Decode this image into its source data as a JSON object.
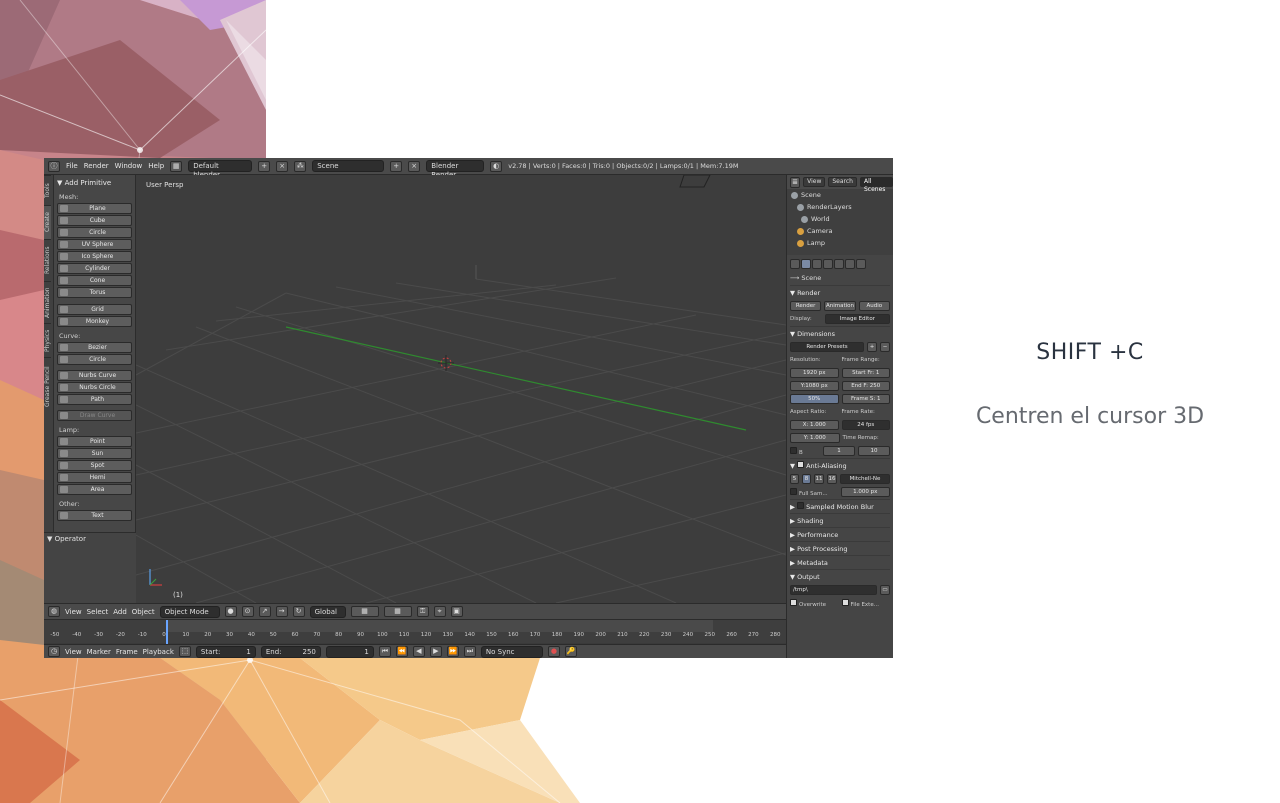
{
  "slide": {
    "title": "SHIFT +C",
    "body": "Centren el cursor 3D"
  },
  "blender": {
    "top_menu": [
      "File",
      "Render",
      "Window",
      "Help"
    ],
    "layout": "Default blender",
    "scene": "Scene",
    "engine": "Blender Render",
    "stats": "v2.78 | Verts:0 | Faces:0 | Tris:0 | Objects:0/2 | Lamps:0/1 | Mem:7.19M",
    "tabs": [
      "Tools",
      "Create",
      "Relations",
      "Animation",
      "Physics",
      "Grease Pencil"
    ],
    "shelf": {
      "header": "▼ Add Primitive",
      "mesh_label": "Mesh:",
      "mesh": [
        "Plane",
        "Cube",
        "Circle",
        "UV Sphere",
        "Ico Sphere",
        "Cylinder",
        "Cone",
        "Torus"
      ],
      "mesh2": [
        "Grid",
        "Monkey"
      ],
      "curve_label": "Curve:",
      "curve": [
        "Bezier",
        "Circle"
      ],
      "nurbs": [
        "Nurbs Curve",
        "Nurbs Circle",
        "Path"
      ],
      "draw_curve": "Draw Curve",
      "lamp_label": "Lamp:",
      "lamp": [
        "Point",
        "Sun",
        "Spot",
        "Hemi",
        "Area"
      ],
      "other_label": "Other:",
      "other": [
        "Text"
      ],
      "operator": "▼ Operator"
    },
    "viewport": {
      "label": "User Persp",
      "frame": "(1)"
    },
    "header3d": {
      "menus": [
        "View",
        "Select",
        "Add",
        "Object"
      ],
      "mode": "Object Mode",
      "orientation": "Global"
    },
    "ruler": [
      "-50",
      "-40",
      "-30",
      "-20",
      "-10",
      "0",
      "10",
      "20",
      "30",
      "40",
      "50",
      "60",
      "70",
      "80",
      "90",
      "100",
      "110",
      "120",
      "130",
      "140",
      "150",
      "160",
      "170",
      "180",
      "190",
      "200",
      "210",
      "220",
      "230",
      "240",
      "250",
      "260",
      "270",
      "280"
    ],
    "footer": {
      "menus": [
        "View",
        "Marker",
        "Frame",
        "Playback"
      ],
      "start": "Start:",
      "start_val": "1",
      "end": "End:",
      "end_val": "250",
      "current": "1",
      "sync": "No Sync"
    },
    "outliner": {
      "buttons": [
        "View",
        "Search",
        "All Scenes"
      ],
      "rows": [
        "Scene",
        "RenderLayers",
        "World",
        "Camera",
        "Lamp"
      ]
    },
    "props": {
      "scene_line": "Scene",
      "render_panel": "▼ Render",
      "render_buttons": [
        "Render",
        "Animation",
        "Audio"
      ],
      "display_label": "Display:",
      "display_value": "Image Editor",
      "dimensions_panel": "▼ Dimensions",
      "presets": "Render Presets",
      "resolution_label": "Resolution:",
      "frame_range_label": "Frame Range:",
      "res_x": "1920 px",
      "res_y": "Y:1080 px",
      "res_pct": "50%",
      "start_fr": "Start Fr: 1",
      "end_fr": "End F: 250",
      "frame_step": "Frame S: 1",
      "aspect_label": "Aspect Ratio:",
      "frame_rate_label": "Frame Rate:",
      "aspect_x": "X: 1.000",
      "aspect_y": "Y: 1.000",
      "fps": "24 fps",
      "time_remap": "Time Remap:",
      "remap_old": "1",
      "remap_new": "10",
      "border_b": "B",
      "aa_panel": "Anti-Aliasing",
      "aa_samples": [
        "5",
        "8",
        "11",
        "16"
      ],
      "aa_filter": "Mitchell-Ne",
      "full_sample": "Full Sam...",
      "filter_size": "1.000 px",
      "motion_blur": "Sampled Motion Blur",
      "collapsed": [
        "▶ Shading",
        "▶ Performance",
        "▶ Post Processing",
        "▶ Metadata"
      ],
      "output_panel": "▼ Output",
      "output_path": "/tmp\\",
      "overwrite": "Overwrite",
      "file_ext": "File Exte..."
    }
  }
}
